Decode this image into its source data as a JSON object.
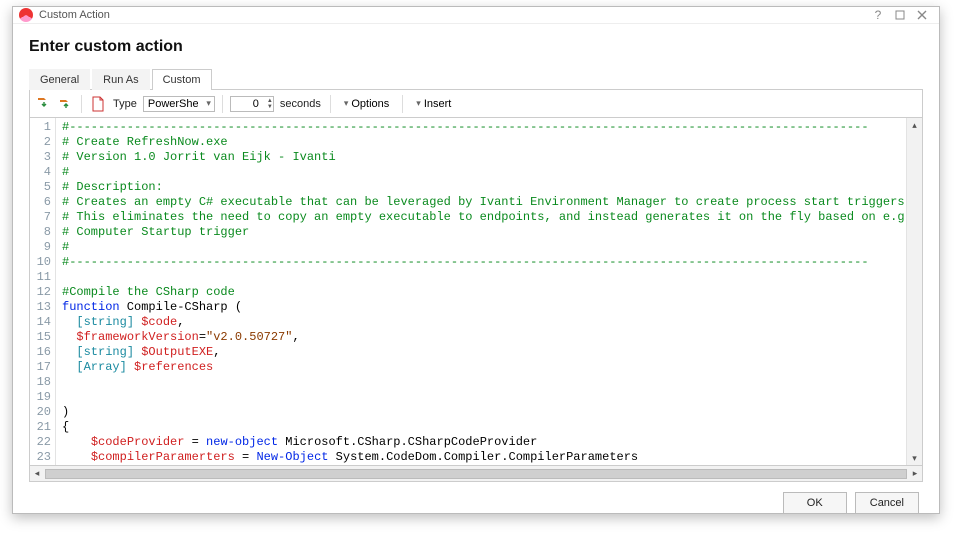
{
  "window": {
    "title": "Custom Action"
  },
  "heading": "Enter custom action",
  "tabs": {
    "general": "General",
    "runas": "Run As",
    "custom": "Custom",
    "active": "custom"
  },
  "toolbar": {
    "type_label": "Type",
    "type_value": "PowerShell",
    "timeout_value": "0",
    "timeout_unit": "seconds",
    "options_label": "Options",
    "insert_label": "Insert"
  },
  "code_lines": [
    {
      "n": 1,
      "tokens": [
        {
          "t": "#---------------------------------------------------------------------------------------------------------------",
          "c": "comment"
        }
      ]
    },
    {
      "n": 2,
      "tokens": [
        {
          "t": "# Create RefreshNow.exe",
          "c": "comment"
        }
      ]
    },
    {
      "n": 3,
      "tokens": [
        {
          "t": "# Version 1.0 Jorrit van Eijk - Ivanti",
          "c": "comment"
        }
      ]
    },
    {
      "n": 4,
      "tokens": [
        {
          "t": "#",
          "c": "comment"
        }
      ]
    },
    {
      "n": 5,
      "tokens": [
        {
          "t": "# Description:",
          "c": "comment"
        }
      ]
    },
    {
      "n": 6,
      "tokens": [
        {
          "t": "# Creates an empty C# executable that can be leveraged by Ivanti Environment Manager to create process start triggers.",
          "c": "comment"
        }
      ]
    },
    {
      "n": 7,
      "tokens": [
        {
          "t": "# This eliminates the need to copy an empty executable to endpoints, and instead generates it on the fly based on e.g.",
          "c": "comment"
        }
      ]
    },
    {
      "n": 8,
      "tokens": [
        {
          "t": "# Computer Startup trigger",
          "c": "comment"
        }
      ]
    },
    {
      "n": 9,
      "tokens": [
        {
          "t": "#",
          "c": "comment"
        }
      ]
    },
    {
      "n": 10,
      "tokens": [
        {
          "t": "#---------------------------------------------------------------------------------------------------------------",
          "c": "comment"
        }
      ]
    },
    {
      "n": 11,
      "tokens": [
        {
          "t": "",
          "c": "plain"
        }
      ]
    },
    {
      "n": 12,
      "tokens": [
        {
          "t": "#Compile the CSharp code",
          "c": "comment"
        }
      ]
    },
    {
      "n": 13,
      "tokens": [
        {
          "t": "function",
          "c": "keyword"
        },
        {
          "t": " Compile-CSharp (",
          "c": "plain"
        }
      ]
    },
    {
      "n": 14,
      "tokens": [
        {
          "t": "  ",
          "c": "plain"
        },
        {
          "t": "[string]",
          "c": "type"
        },
        {
          "t": " ",
          "c": "plain"
        },
        {
          "t": "$code",
          "c": "var"
        },
        {
          "t": ",",
          "c": "plain"
        }
      ]
    },
    {
      "n": 15,
      "tokens": [
        {
          "t": "  ",
          "c": "plain"
        },
        {
          "t": "$frameworkVersion",
          "c": "var"
        },
        {
          "t": "=",
          "c": "plain"
        },
        {
          "t": "\"v2.0.50727\"",
          "c": "string"
        },
        {
          "t": ",",
          "c": "plain"
        }
      ]
    },
    {
      "n": 16,
      "tokens": [
        {
          "t": "  ",
          "c": "plain"
        },
        {
          "t": "[string]",
          "c": "type"
        },
        {
          "t": " ",
          "c": "plain"
        },
        {
          "t": "$OutputEXE",
          "c": "var"
        },
        {
          "t": ",",
          "c": "plain"
        }
      ]
    },
    {
      "n": 17,
      "tokens": [
        {
          "t": "  ",
          "c": "plain"
        },
        {
          "t": "[Array]",
          "c": "type"
        },
        {
          "t": " ",
          "c": "plain"
        },
        {
          "t": "$references",
          "c": "var"
        }
      ]
    },
    {
      "n": 18,
      "tokens": [
        {
          "t": "",
          "c": "plain"
        }
      ]
    },
    {
      "n": 19,
      "tokens": [
        {
          "t": "",
          "c": "plain"
        }
      ]
    },
    {
      "n": 20,
      "tokens": [
        {
          "t": ")",
          "c": "plain"
        }
      ]
    },
    {
      "n": 21,
      "tokens": [
        {
          "t": "{",
          "c": "plain"
        }
      ]
    },
    {
      "n": 22,
      "tokens": [
        {
          "t": "    ",
          "c": "plain"
        },
        {
          "t": "$codeProvider",
          "c": "var"
        },
        {
          "t": " = ",
          "c": "plain"
        },
        {
          "t": "new-object",
          "c": "keyword"
        },
        {
          "t": " Microsoft.CSharp.CSharpCodeProvider",
          "c": "plain"
        }
      ]
    },
    {
      "n": 23,
      "tokens": [
        {
          "t": "    ",
          "c": "plain"
        },
        {
          "t": "$compilerParamerters",
          "c": "var"
        },
        {
          "t": " = ",
          "c": "plain"
        },
        {
          "t": "New-Object",
          "c": "keyword"
        },
        {
          "t": " System.CodeDom.Compiler.CompilerParameters",
          "c": "plain"
        }
      ]
    }
  ],
  "buttons": {
    "ok": "OK",
    "cancel": "Cancel"
  }
}
